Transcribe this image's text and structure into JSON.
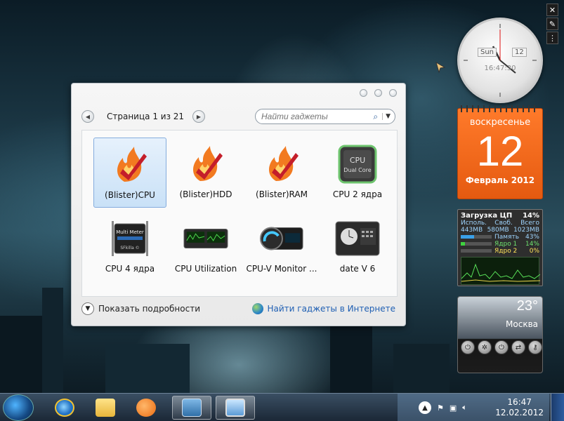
{
  "dialog": {
    "page_label": "Страница 1 из 21",
    "search_placeholder": "Найти гаджеты",
    "gadgets": [
      {
        "label": "(Blister)CPU",
        "icon": "flame-check-icon",
        "selected": true
      },
      {
        "label": "(Blister)HDD",
        "icon": "flame-check-icon",
        "selected": false
      },
      {
        "label": "(Blister)RAM",
        "icon": "flame-check-icon",
        "selected": false
      },
      {
        "label": "CPU 2 ядра",
        "icon": "cpu-chip-icon",
        "selected": false
      },
      {
        "label": "CPU 4 ядра",
        "icon": "multimeter-chip-icon",
        "selected": false
      },
      {
        "label": "CPU Utilization",
        "icon": "cpu-graph-icon",
        "selected": false
      },
      {
        "label": "CPU-V Monitor ...",
        "icon": "gauge-monitor-icon",
        "selected": false
      },
      {
        "label": "date V 6",
        "icon": "clock-calendar-icon",
        "selected": false
      }
    ],
    "show_details": "Показать подробности",
    "online_link": "Найти гаджеты в Интернете"
  },
  "clock": {
    "day_box": "Sun",
    "date_box": "12",
    "digital": "16:47:30"
  },
  "calendar": {
    "weekday": "воскресенье",
    "day": "12",
    "month_year": "Февраль 2012"
  },
  "cpu_meter": {
    "title": "Загрузка ЦП",
    "load": "14%",
    "headers": [
      "Исполь.",
      "Своб.",
      "Всего"
    ],
    "values": [
      "443MB",
      "580MB",
      "1023MB"
    ],
    "memory_label": "Память",
    "memory_value": "43%",
    "core1_label": "Ядро 1",
    "core1_value": "14%",
    "core2_label": "Ядро 2",
    "core2_value": "0%"
  },
  "weather": {
    "temp": "23°",
    "city": "Москва"
  },
  "taskbar": {
    "time": "16:47",
    "date": "12.02.2012"
  },
  "colors": {
    "calendar": "#e55a10",
    "link": "#1f5fb3",
    "selection": "#c9e1f7"
  }
}
